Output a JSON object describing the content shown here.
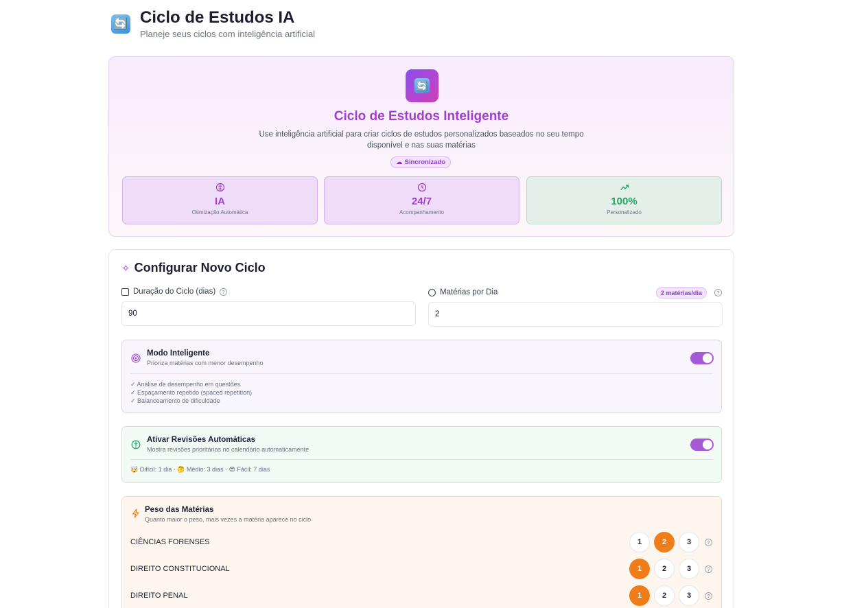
{
  "header": {
    "logo_glyph": "🔄",
    "title": "Ciclo de Estudos IA",
    "subtitle": "Planeje seus ciclos com inteligência artificial"
  },
  "hero": {
    "logo_glyph": "🔄",
    "title": "Ciclo de Estudos Inteligente",
    "description": "Use inteligência artificial para criar ciclos de estudos personalizados baseados no seu tempo disponível e nas suas matérias",
    "badge": "Sincronizado",
    "stats": [
      {
        "icon": "brain-icon",
        "value": "IA",
        "label": "Otimização Automática",
        "color": "#a23fd1"
      },
      {
        "icon": "clock-icon",
        "value": "24/7",
        "label": "Acompanhamento",
        "color": "#a23fd1"
      },
      {
        "icon": "trending-up-icon",
        "value": "100%",
        "label": "Personalizado",
        "color": "#21a565"
      }
    ]
  },
  "config": {
    "title": "Configurar Novo Ciclo",
    "duration": {
      "label": "Duração do Ciclo (dias)",
      "value": "90"
    },
    "per_day": {
      "label": "Matérias por Dia",
      "badge": "2 matérias/dia",
      "value": "2"
    },
    "smart_mode": {
      "title": "Modo Inteligente",
      "subtitle": "Prioriza matérias com menor desempenho",
      "features": [
        "✓ Análise de desempenho em questões",
        "✓ Espaçamento repetido (spaced repetition)",
        "✓ Balanceamento de dificuldade"
      ],
      "enabled": true
    },
    "revisions": {
      "title": "Ativar Revisões Automáticas",
      "subtitle": "Mostra revisões prioritárias no calendário automaticamente",
      "legend": "🤯 Difícil: 1 dia · 🤔 Médio: 3 dias · 😎 Fácil: 7 dias",
      "enabled": true
    },
    "weights": {
      "title": "Peso das Matérias",
      "subtitle": "Quanto maior o peso, mais vezes a matéria aparece no ciclo",
      "options": [
        "1",
        "2",
        "3"
      ],
      "subjects": [
        {
          "name": "CIÊNCIAS FORENSES",
          "weight": 2
        },
        {
          "name": "DIREITO CONSTITUCIONAL",
          "weight": 1
        },
        {
          "name": "DIREITO PENAL",
          "weight": 1
        }
      ]
    }
  },
  "colors": {
    "accent": "#a23fd1",
    "green": "#21a565",
    "orange": "#f07c1a",
    "toggle": "#a75ad8"
  }
}
